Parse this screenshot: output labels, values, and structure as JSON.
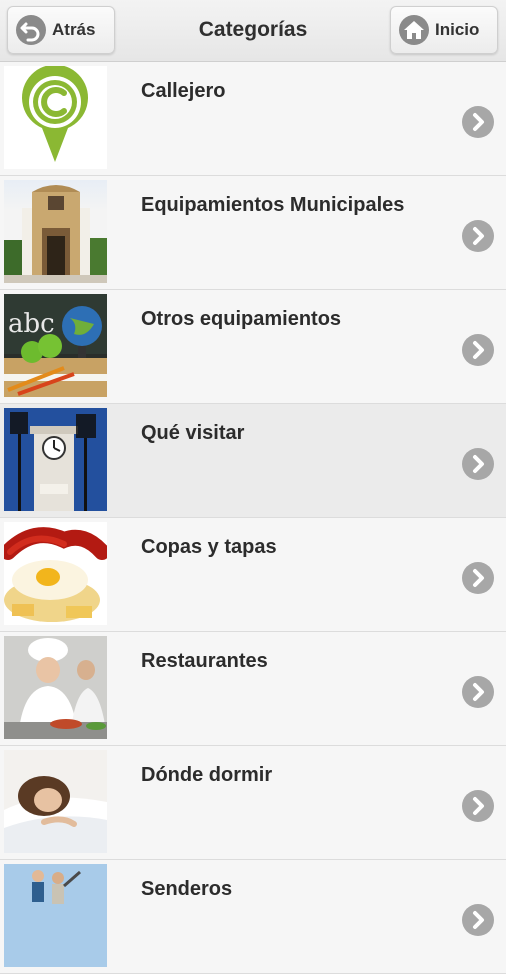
{
  "header": {
    "back_label": "Atrás",
    "home_label": "Inicio",
    "title": "Categorías"
  },
  "categories": [
    {
      "label": "Callejero",
      "thumb": "map-pin-logo"
    },
    {
      "label": "Equipamientos Municipales",
      "thumb": "municipal-building-photo"
    },
    {
      "label": "Otros equipamientos",
      "thumb": "school-supplies-photo"
    },
    {
      "label": "Qué visitar",
      "thumb": "clock-tower-photo"
    },
    {
      "label": "Copas y tapas",
      "thumb": "tapas-food-photo"
    },
    {
      "label": "Restaurantes",
      "thumb": "chefs-kitchen-photo"
    },
    {
      "label": "Dónde dormir",
      "thumb": "sleeping-woman-photo"
    },
    {
      "label": "Senderos",
      "thumb": "hikers-photo"
    }
  ],
  "active_index": 3,
  "colors": {
    "accent_green": "#8bb833",
    "chevron": "#a7a7a7"
  }
}
